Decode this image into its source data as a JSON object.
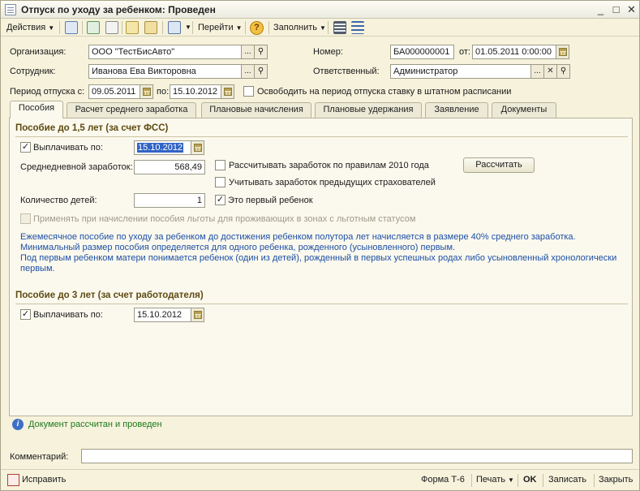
{
  "window": {
    "title": "Отпуск по уходу за ребенком: Проведен",
    "controls": [
      "_",
      "□",
      "✕"
    ]
  },
  "toolbar": {
    "actions_label": "Действия",
    "goto_label": "Перейти",
    "help_label": "?",
    "fill_label": "Заполнить"
  },
  "header": {
    "org_label": "Организация:",
    "org_value": "ООО \"ТестБисАвто\"",
    "number_label": "Номер:",
    "number_value": "БА000000001",
    "from_label": "от:",
    "date_value": "01.05.2011  0:00:00",
    "employee_label": "Сотрудник:",
    "employee_value": "Иванова Ева Викторовна",
    "responsible_label": "Ответственный:",
    "responsible_value": "Администратор",
    "period_label": "Период отпуска с:",
    "period_from": "09.05.2011",
    "period_to_label": "по:",
    "period_to": "15.10.2012",
    "release_rate_label": "Освободить на период отпуска ставку в штатном расписании",
    "ellipsis": "...",
    "search_glyph": "⚲",
    "clear_glyph": "✕"
  },
  "tabs": [
    {
      "label": "Пособия",
      "active": true
    },
    {
      "label": "Расчет среднего заработка",
      "active": false
    },
    {
      "label": "Плановые начисления",
      "active": false
    },
    {
      "label": "Плановые удержания",
      "active": false
    },
    {
      "label": "Заявление",
      "active": false
    },
    {
      "label": "Документы",
      "active": false
    }
  ],
  "section1": {
    "title": "Пособие до 1,5 лет (за счет ФСС)",
    "pay_until_label": "Выплачивать по:",
    "pay_until_value": "15.10.2012",
    "avg_salary_label": "Среднедневной заработок:",
    "avg_salary_value": "568,49",
    "rules2010_label": "Рассчитывать заработок по правилам 2010 года",
    "prev_insurers_label": "Учитывать заработок предыдущих страхователей",
    "calculate_label": "Рассчитать",
    "children_label": "Количество детей:",
    "children_value": "1",
    "first_child_label": "Это первый ребенок",
    "benefits_zone_label": "Применять при начислении пособия льготы для проживающих в зонах с льготным статусом",
    "info_lines": [
      "Ежемесячное пособие по уходу за ребенком до достижения ребенком полутора лет начисляется в размере 40% среднего заработка.",
      "Минимальный размер пособия определяется для одного ребенка, рожденного (усыновленного) первым.",
      "Под первым ребенком матери понимается ребенок (один из детей), рожденный в первых успешных родах либо усыновленный хронологически",
      "первым."
    ]
  },
  "section2": {
    "title": "Пособие до 3 лет (за счет работодателя)",
    "pay_until_label": "Выплачивать по:",
    "pay_until_value": "15.10.2012"
  },
  "status": {
    "icon": "i",
    "text": "Документ рассчитан и проведен"
  },
  "comment": {
    "label": "Комментарий:",
    "value": ""
  },
  "footer": {
    "fix_label": "Исправить",
    "form_label": "Форма Т-6",
    "print_label": "Печать",
    "ok_label": "OK",
    "save_label": "Записать",
    "close_label": "Закрыть"
  },
  "colors": {
    "window_bg": "#f6f2dc",
    "section_title": "#5e4a10",
    "info_text": "#1c4fa5",
    "status_text": "#1c7a1c",
    "selection": "#3163c5"
  }
}
